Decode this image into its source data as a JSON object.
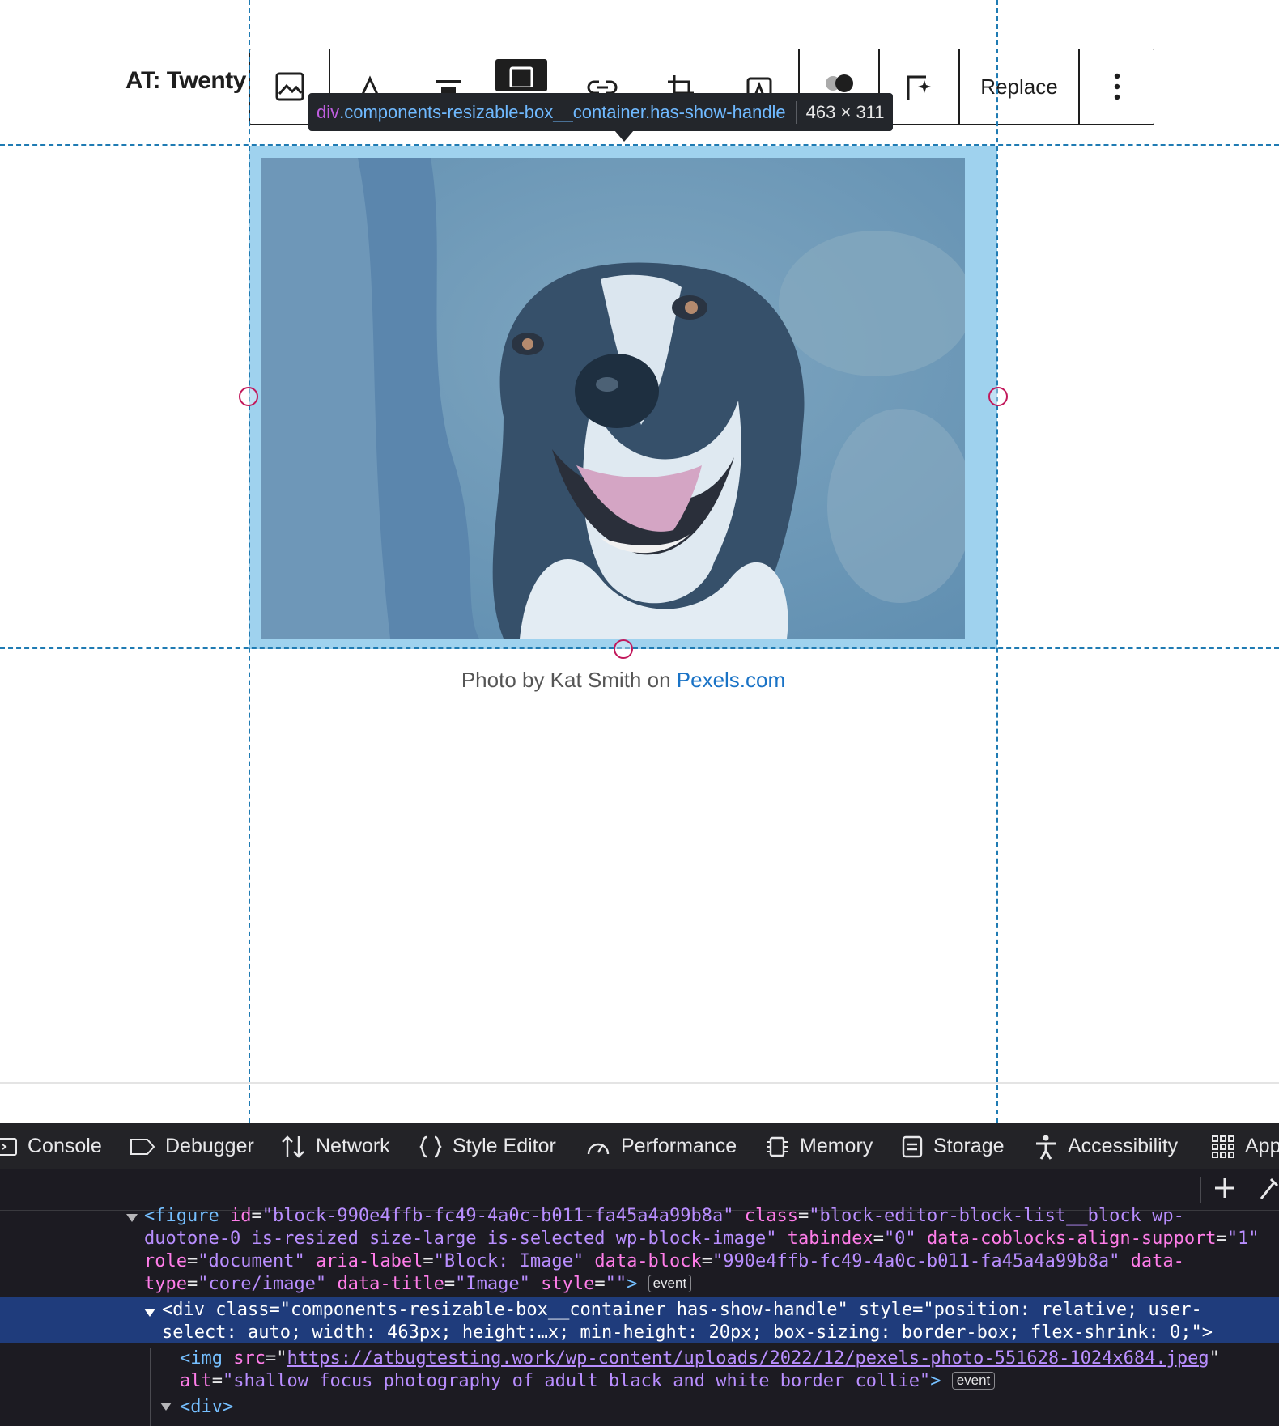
{
  "site": {
    "title": "AT: Twenty"
  },
  "toolbar": {
    "icons": [
      "image-block-icon",
      "duotone-filter-icon",
      "align-top-icon",
      "align-wide-icon",
      "link-icon",
      "crop-icon",
      "text-overlay-icon",
      "toggle-icon",
      "ai-sparkle-icon",
      "more-options-icon"
    ],
    "replace_label": "Replace"
  },
  "inspector_tooltip": {
    "tag": "div",
    "classes": ".components-resizable-box__container.has-show-handle",
    "size": "463 × 311"
  },
  "image": {
    "alt": "shallow focus photography of adult black and white border collie",
    "caption_prefix": "Photo by Kat Smith on ",
    "caption_link": "Pexels.com"
  },
  "devtools": {
    "tabs": [
      {
        "label": "Console",
        "icon": "console-icon"
      },
      {
        "label": "Debugger",
        "icon": "debugger-icon"
      },
      {
        "label": "Network",
        "icon": "network-icon"
      },
      {
        "label": "Style Editor",
        "icon": "style-editor-icon"
      },
      {
        "label": "Performance",
        "icon": "performance-icon"
      },
      {
        "label": "Memory",
        "icon": "memory-icon"
      },
      {
        "label": "Storage",
        "icon": "storage-icon"
      },
      {
        "label": "Accessibility",
        "icon": "accessibility-icon"
      },
      {
        "label": "App",
        "icon": "application-icon"
      }
    ],
    "badge": "event",
    "code": {
      "l1_a": "<figure ",
      "l1_id_name": "id",
      "l1_id_val": "\"block-990e4ffb-fc49-4a0c-b011-fa45a4a99b8a\"",
      "l1_class_name": "class",
      "l1_class_val": "\"block-editor-block-list__block wp-",
      "l2_class_val": "duotone-0 is-resized size-large is-selected wp-block-image\"",
      "l2_tab_name": "tabindex",
      "l2_tab_val": "\"0\"",
      "l2_align_name": "data-coblocks-align-support",
      "l2_align_val": "\"1\"",
      "l3_role_name": "role",
      "l3_role_val": "\"document\"",
      "l3_aria_name": "aria-label",
      "l3_aria_val": "\"Block: Image\"",
      "l3_block_name": "data-block",
      "l3_block_val": "\"990e4ffb-fc49-4a0c-b011-fa45a4a99b8a\"",
      "l3_data": "data-",
      "l4_type_name": "type",
      "l4_type_val": "\"core/image\"",
      "l4_title_name": "data-title",
      "l4_title_val": "\"Image\"",
      "l4_style_name": "style",
      "l4_style_val": "\"\"",
      "l4_end": ">",
      "l5": "<div class=\"components-resizable-box__container has-show-handle\" style=\"position: relative; user-",
      "l6": "select: auto; width: 463px; height:…x; min-height: 20px; box-sizing: border-box; flex-shrink: 0;\">",
      "l7_a": "<img ",
      "l7_src_name": "src",
      "l7_src_val": "https://atbugtesting.work/wp-content/uploads/2022/12/pexels-photo-551628-1024x684.jpeg",
      "l8_alt_name": "alt",
      "l8_alt_val": "\"shallow focus photography of adult black and white border collie\"",
      "l8_end": ">",
      "l9": "<div>"
    }
  },
  "colors": {
    "highlight": "#9fd2ee",
    "guide": "#1f7bb3",
    "handle": "#c2185b",
    "link": "#1a73c6"
  }
}
